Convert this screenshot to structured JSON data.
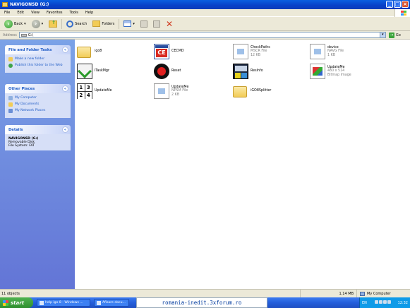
{
  "window": {
    "title": "NAVIGONSD (G:)"
  },
  "menu": [
    "File",
    "Edit",
    "View",
    "Favorites",
    "Tools",
    "Help"
  ],
  "toolbar": {
    "back": "Back",
    "search": "Search",
    "folders": "Folders"
  },
  "address": {
    "label": "Address",
    "value": "G:\\",
    "go": "Go"
  },
  "sidebar": {
    "tasks": {
      "title": "File and Folder Tasks",
      "items": [
        "Make a new folder",
        "Publish this folder to the Web"
      ]
    },
    "places": {
      "title": "Other Places",
      "items": [
        "My Computer",
        "My Documents",
        "My Network Places"
      ]
    },
    "details": {
      "title": "Details",
      "name": "NAVIGONSD (G:)",
      "type": "Removable Disk",
      "fs": "File System: FAT"
    }
  },
  "files": [
    {
      "name": "igo8",
      "sub1": "",
      "sub2": "",
      "icon": "folder-icon"
    },
    {
      "name": "CECMD",
      "sub1": "",
      "sub2": "",
      "icon": "ce-app-icon"
    },
    {
      "name": "CheckPaths",
      "sub1": "MSCR File",
      "sub2": "12 KB",
      "icon": "document-icon"
    },
    {
      "name": "device",
      "sub1": "NAVG File",
      "sub2": "1 KB",
      "icon": "document-icon"
    },
    {
      "name": "ITaskMgr",
      "sub1": "",
      "sub2": "",
      "icon": "task-manager-icon"
    },
    {
      "name": "Reset",
      "sub1": "",
      "sub2": "",
      "icon": "reset-icon"
    },
    {
      "name": "ResInfo",
      "sub1": "",
      "sub2": "",
      "icon": "resinfo-icon"
    },
    {
      "name": "UpdateMe",
      "sub1": "480 x 514",
      "sub2": "Bitmap Image",
      "icon": "bitmap-icon"
    },
    {
      "name": "UpdateMe",
      "sub1": "",
      "sub2": "",
      "icon": "grid-app-icon"
    },
    {
      "name": "UpdateMe",
      "sub1": "NPSM File",
      "sub2": "2 KB",
      "icon": "document-icon"
    },
    {
      "name": "iGO8Splitter",
      "sub1": "",
      "sub2": "",
      "icon": "folder-icon"
    }
  ],
  "status": {
    "objects": "11 objects",
    "size": "1,14 MB",
    "location": "My Computer"
  },
  "taskbar": {
    "start": "start",
    "tasks": [
      "help igo 8 - Windows ...",
      "Afisare docu..."
    ],
    "url": "romania-inedit.3xforum.ro",
    "lang": "EN",
    "time": "12:32"
  }
}
